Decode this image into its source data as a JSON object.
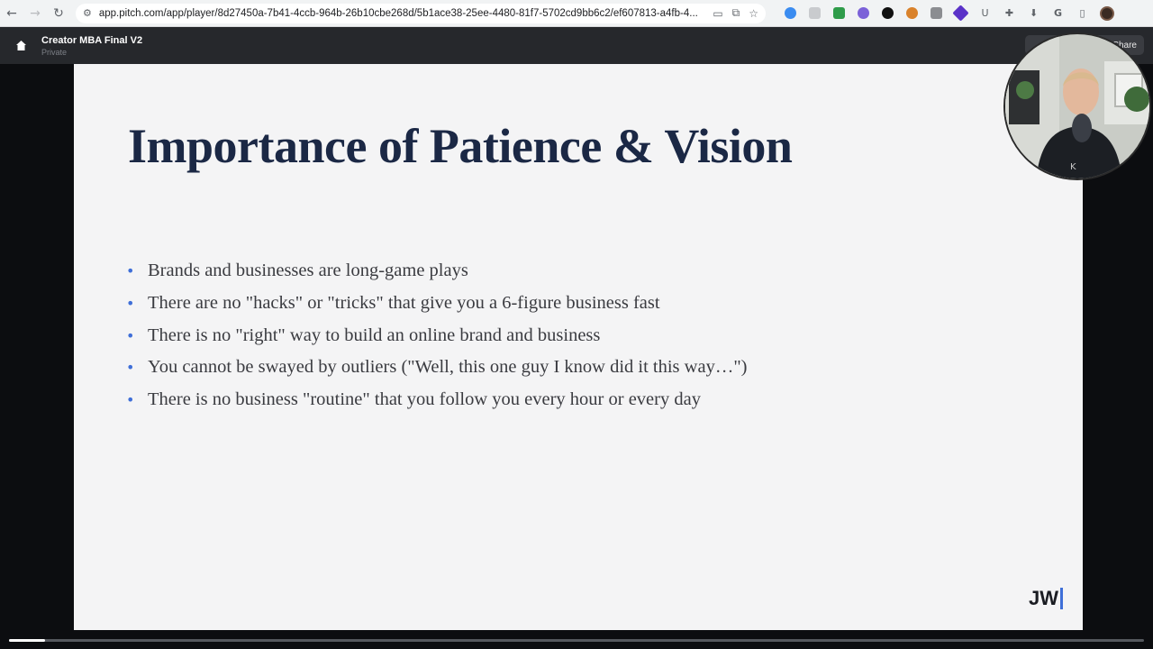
{
  "browser": {
    "url": "app.pitch.com/app/player/8d27450a-7b41-4ccb-964b-26b10cbe268d/5b1ace38-25ee-4480-81f7-5702cd9bb6c2/ef607813-a4fb-4...",
    "back_icon": "back-arrow-icon",
    "forward_icon": "forward-arrow-icon",
    "reload_icon": "reload-icon"
  },
  "header": {
    "deck_title": "Creator MBA Final V2",
    "deck_visibility": "Private",
    "share_label": "Share"
  },
  "slide": {
    "title": "Importance of Patience & Vision",
    "bullets": [
      "Brands and businesses are long-game plays",
      "There are no \"hacks\" or \"tricks\" that give you a 6-figure business fast",
      "There is no \"right\" way to build an online brand and business",
      "You cannot be swayed by outliers (\"Well, this one guy I know did it this way…\")",
      "There is no business \"routine\" that you follow you every hour or every day"
    ],
    "logo_text": "JW"
  },
  "colors": {
    "title": "#1b2845",
    "bullet_accent": "#3f6fd8",
    "header_bg": "#26282c"
  },
  "progress": {
    "fraction": 0.032
  }
}
